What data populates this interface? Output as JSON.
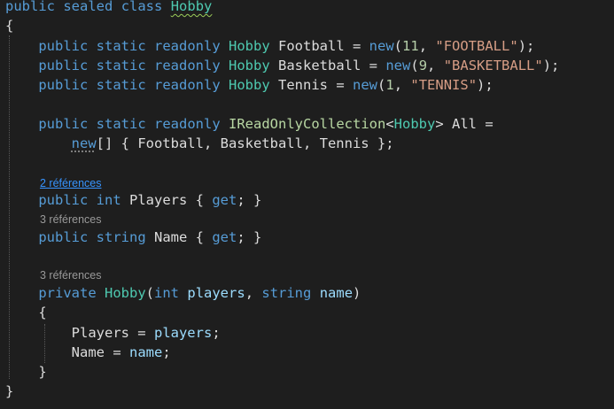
{
  "colors": {
    "background": "#1e1e1e",
    "keyword": "#569cd6",
    "type": "#4ec9b0",
    "interface": "#b8d7a3",
    "identifier": "#dcdcdc",
    "number": "#b5cea8",
    "string": "#d69d85",
    "parameter": "#9cdcfe",
    "codelens": "#999999",
    "codelens_link": "#3794ff",
    "guide": "#5a5a5a"
  },
  "codelens": {
    "players": "2 références",
    "name": "3 références",
    "ctor": "3 références"
  },
  "lines": [
    [
      {
        "t": "public",
        "k": "keyword"
      },
      {
        "t": " "
      },
      {
        "t": "sealed",
        "k": "keyword"
      },
      {
        "t": " "
      },
      {
        "t": "class",
        "k": "keyword"
      },
      {
        "t": " "
      },
      {
        "t": "Hobby",
        "k": "type",
        "d": "warn"
      }
    ],
    [
      {
        "t": "{"
      }
    ],
    [
      {
        "t": "    "
      },
      {
        "t": "public",
        "k": "keyword"
      },
      {
        "t": " "
      },
      {
        "t": "static",
        "k": "keyword"
      },
      {
        "t": " "
      },
      {
        "t": "readonly",
        "k": "keyword"
      },
      {
        "t": " "
      },
      {
        "t": "Hobby",
        "k": "type"
      },
      {
        "t": " Football = "
      },
      {
        "t": "new",
        "k": "keyword"
      },
      {
        "t": "("
      },
      {
        "t": "11",
        "k": "number"
      },
      {
        "t": ", "
      },
      {
        "t": "\"FOOTBALL\"",
        "k": "string"
      },
      {
        "t": ");"
      }
    ],
    [
      {
        "t": "    "
      },
      {
        "t": "public",
        "k": "keyword"
      },
      {
        "t": " "
      },
      {
        "t": "static",
        "k": "keyword"
      },
      {
        "t": " "
      },
      {
        "t": "readonly",
        "k": "keyword"
      },
      {
        "t": " "
      },
      {
        "t": "Hobby",
        "k": "type"
      },
      {
        "t": " Basketball = "
      },
      {
        "t": "new",
        "k": "keyword"
      },
      {
        "t": "("
      },
      {
        "t": "9",
        "k": "number"
      },
      {
        "t": ", "
      },
      {
        "t": "\"BASKETBALL\"",
        "k": "string"
      },
      {
        "t": ");"
      }
    ],
    [
      {
        "t": "    "
      },
      {
        "t": "public",
        "k": "keyword"
      },
      {
        "t": " "
      },
      {
        "t": "static",
        "k": "keyword"
      },
      {
        "t": " "
      },
      {
        "t": "readonly",
        "k": "keyword"
      },
      {
        "t": " "
      },
      {
        "t": "Hobby",
        "k": "type"
      },
      {
        "t": " Tennis = "
      },
      {
        "t": "new",
        "k": "keyword"
      },
      {
        "t": "("
      },
      {
        "t": "1",
        "k": "number"
      },
      {
        "t": ", "
      },
      {
        "t": "\"TENNIS\"",
        "k": "string"
      },
      {
        "t": ");"
      }
    ],
    [
      {
        "t": "    "
      },
      {
        "t": "public",
        "k": "keyword"
      },
      {
        "t": " "
      },
      {
        "t": "static",
        "k": "keyword"
      },
      {
        "t": " "
      },
      {
        "t": "readonly",
        "k": "keyword"
      },
      {
        "t": " "
      },
      {
        "t": "IReadOnlyCollection",
        "k": "interface"
      },
      {
        "t": "<"
      },
      {
        "t": "Hobby",
        "k": "type"
      },
      {
        "t": "> All ="
      }
    ],
    [
      {
        "t": "        "
      },
      {
        "t": "new",
        "k": "keyword",
        "d": "dots"
      },
      {
        "t": "[] { Football, Basketball, Tennis };"
      }
    ],
    [
      {
        "t": "    "
      },
      {
        "t": "public",
        "k": "keyword"
      },
      {
        "t": " "
      },
      {
        "t": "int",
        "k": "keyword"
      },
      {
        "t": " Players { "
      },
      {
        "t": "get",
        "k": "keyword"
      },
      {
        "t": "; }"
      }
    ],
    [
      {
        "t": "    "
      },
      {
        "t": "public",
        "k": "keyword"
      },
      {
        "t": " "
      },
      {
        "t": "string",
        "k": "keyword"
      },
      {
        "t": " Name { "
      },
      {
        "t": "get",
        "k": "keyword"
      },
      {
        "t": "; }"
      }
    ],
    [
      {
        "t": "    "
      },
      {
        "t": "private",
        "k": "keyword"
      },
      {
        "t": " "
      },
      {
        "t": "Hobby",
        "k": "type"
      },
      {
        "t": "("
      },
      {
        "t": "int",
        "k": "keyword"
      },
      {
        "t": " "
      },
      {
        "t": "players",
        "k": "parameter"
      },
      {
        "t": ", "
      },
      {
        "t": "string",
        "k": "keyword"
      },
      {
        "t": " "
      },
      {
        "t": "name",
        "k": "parameter"
      },
      {
        "t": ")"
      }
    ],
    [
      {
        "t": "    {"
      }
    ],
    [
      {
        "t": "        Players = "
      },
      {
        "t": "players",
        "k": "parameter"
      },
      {
        "t": ";"
      }
    ],
    [
      {
        "t": "        Name = "
      },
      {
        "t": "name",
        "k": "parameter"
      },
      {
        "t": ";"
      }
    ],
    [
      {
        "t": "    }"
      }
    ],
    [
      {
        "t": "}"
      }
    ]
  ]
}
